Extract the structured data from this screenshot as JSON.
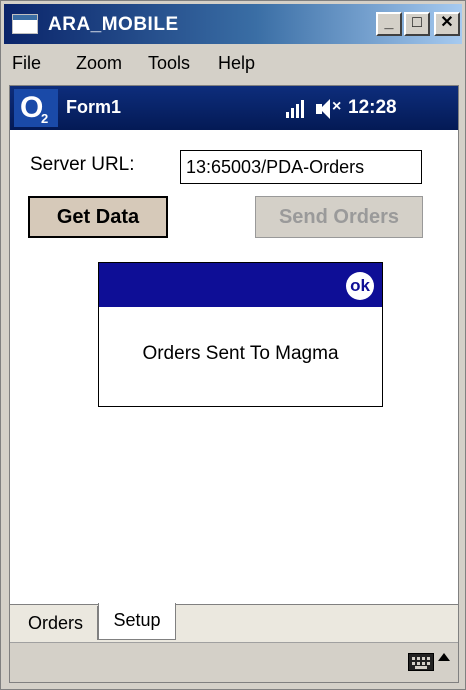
{
  "window": {
    "title": "ARA_MOBILE",
    "min_glyph": "_",
    "max_glyph": "□",
    "close_glyph": "✕"
  },
  "menu": [
    "File",
    "Zoom",
    "Tools",
    "Help"
  ],
  "navbar": {
    "logo_text": "O",
    "logo_sub": "2",
    "form_title": "Form1",
    "clock": "12:28",
    "antenna_icon": "antenna-signal-icon",
    "volume_icon": "speaker-muted-icon"
  },
  "form": {
    "server_label": "Server URL:",
    "server_value": "13:65003/PDA-Orders",
    "get_data_label": "Get Data",
    "send_orders_label": "Send Orders"
  },
  "message": {
    "ok_label": "ok",
    "text": "Orders Sent To Magma"
  },
  "tabs": [
    {
      "label": "Orders",
      "active": false
    },
    {
      "label": "Setup",
      "active": true
    }
  ],
  "taskbar": {
    "keyboard_icon": "keyboard-icon",
    "arrow_icon": "sip-up-arrow-icon"
  },
  "colors": {
    "titlebar_start": "#0a246a",
    "navbar": "#0d2d7c",
    "msg_header": "#0e0e96",
    "disabled_text": "#9a9a9a"
  }
}
